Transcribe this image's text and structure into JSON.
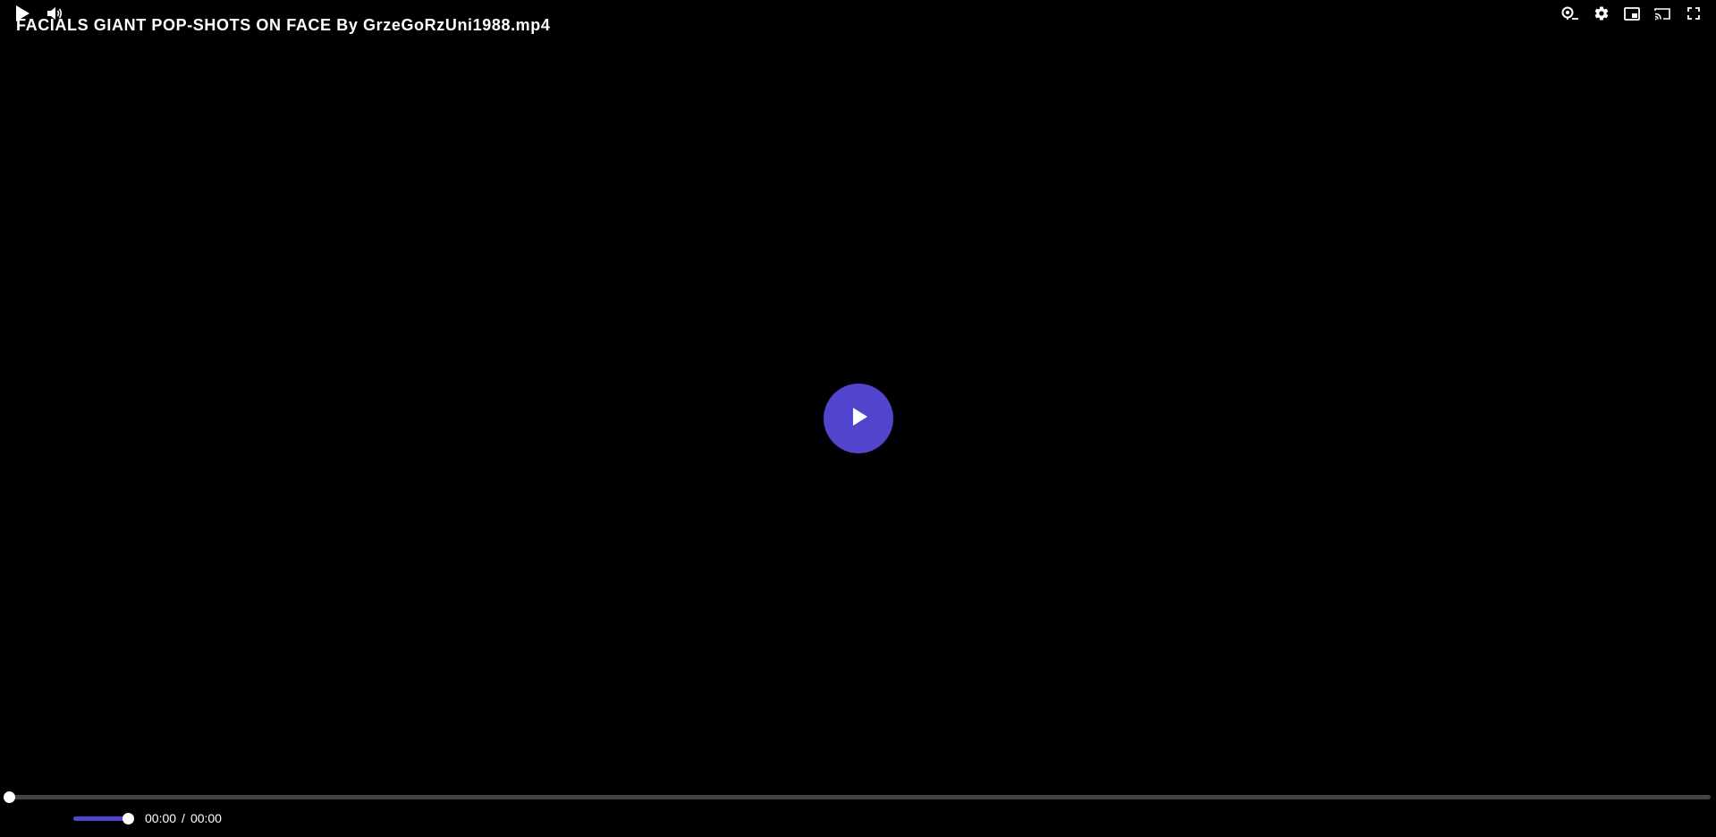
{
  "player": {
    "title": "FACIALS GIANT POP-SHOTS ON FACE By GrzeGoRzUni1988.mp4",
    "accent_color": "#5145cd",
    "background_color": "#000000"
  },
  "controls": {
    "current_time": "00:00",
    "separator": "/",
    "duration": "00:00",
    "progress_fraction": 0,
    "volume_fraction": 1,
    "icons": {
      "big_play": "play-icon",
      "play": "play-icon",
      "volume": "volume-icon",
      "playback_speed": "playback-speed-icon",
      "settings": "gear-icon",
      "picture_in_picture": "picture-in-picture-icon",
      "cast": "cast-icon",
      "fullscreen": "fullscreen-icon"
    }
  }
}
